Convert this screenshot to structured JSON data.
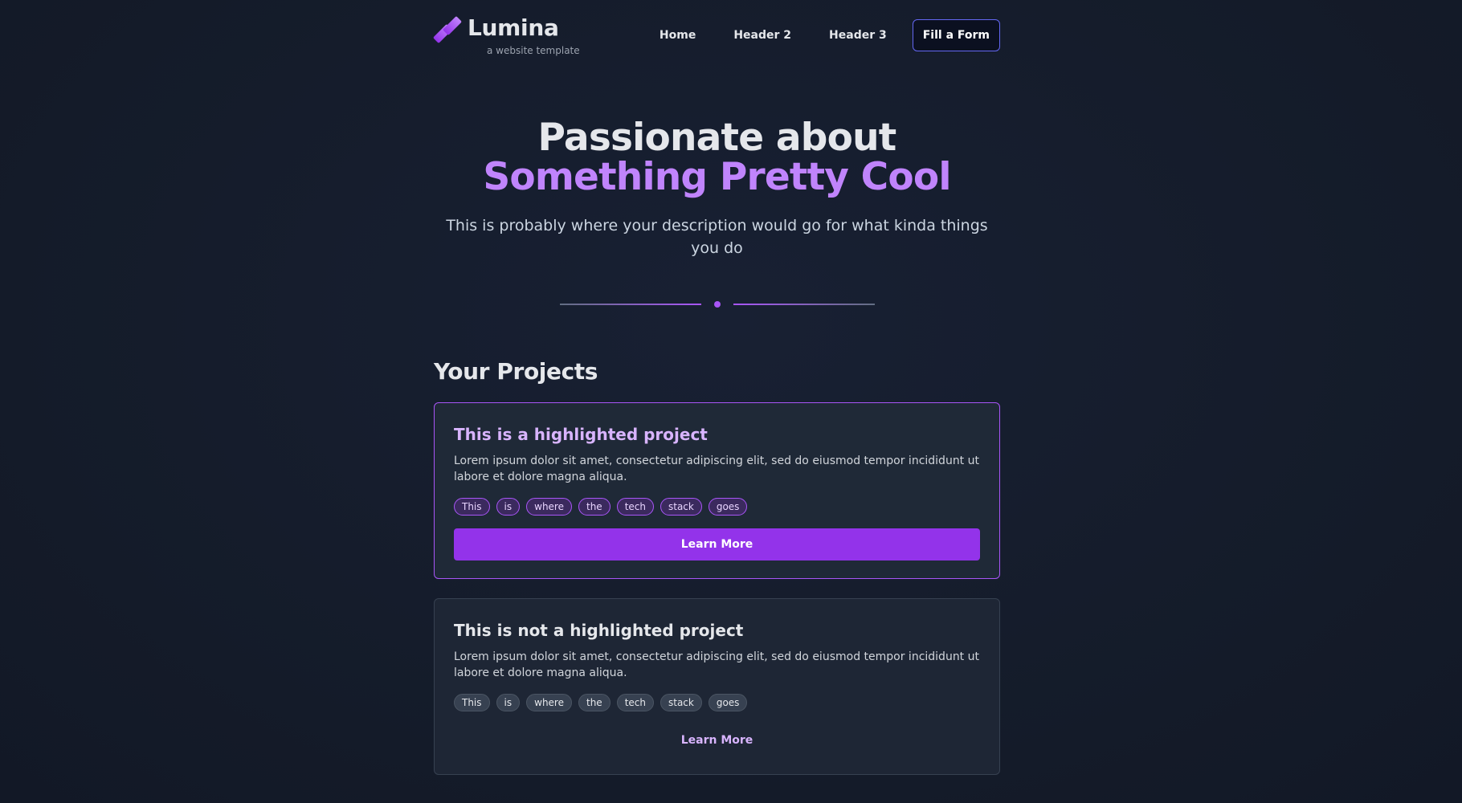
{
  "header": {
    "brand_name": "Lumina",
    "brand_tagline": "a website template",
    "nav": [
      "Home",
      "Header 2",
      "Header 3"
    ],
    "cta_label": "Fill a Form"
  },
  "hero": {
    "title_plain": "Passionate about ",
    "title_accent": "Something Pretty Cool",
    "description": "This is probably where your description would go for what kinda things you do"
  },
  "projects": {
    "section_title": "Your Projects",
    "items": [
      {
        "title": "This is a highlighted project",
        "description": "Lorem ipsum dolor sit amet, consectetur adipiscing elit, sed do eiusmod tempor incididunt ut labore et dolore magna aliqua.",
        "tags": [
          "This",
          "is",
          "where",
          "the",
          "tech",
          "stack",
          "goes"
        ],
        "button_label": "Learn More",
        "highlighted": true
      },
      {
        "title": "This is not a highlighted project",
        "description": "Lorem ipsum dolor sit amet, consectetur adipiscing elit, sed do eiusmod tempor incididunt ut labore et dolore magna aliqua.",
        "tags": [
          "This",
          "is",
          "where",
          "the",
          "tech",
          "stack",
          "goes"
        ],
        "button_label": "Learn More",
        "highlighted": false
      }
    ]
  },
  "colors": {
    "background": "#151c2b",
    "accent": "#c084fc",
    "primary_button": "#9333ea",
    "card": "#1f2937"
  }
}
